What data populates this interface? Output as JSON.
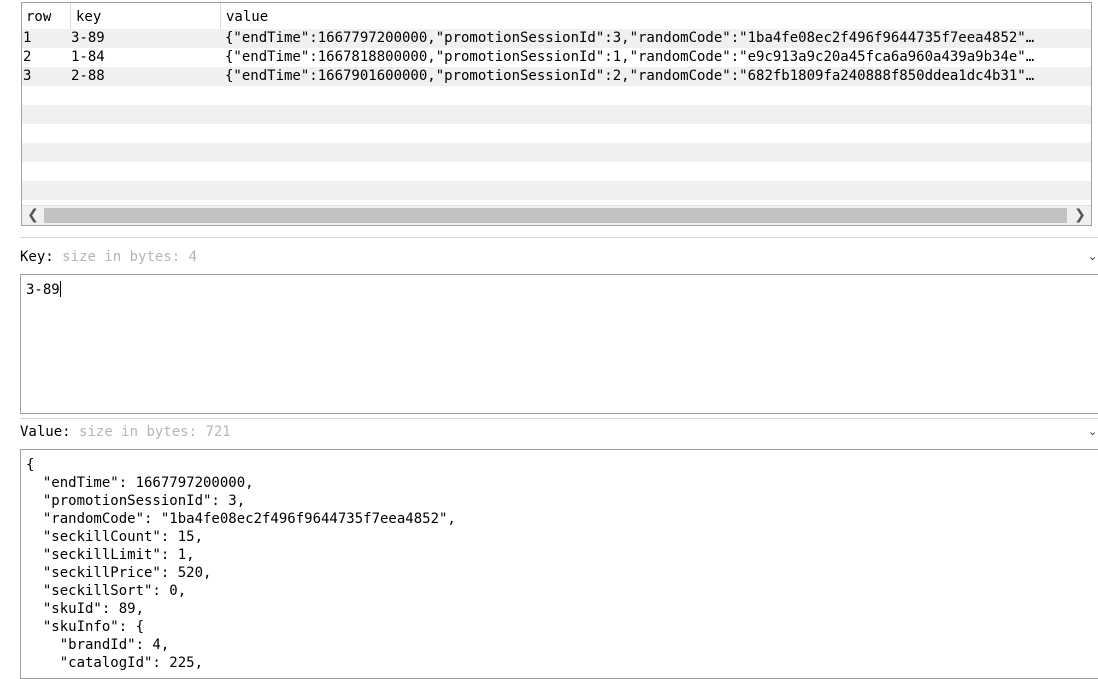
{
  "table": {
    "columns": [
      "row",
      "key",
      "value"
    ],
    "rows": [
      {
        "row": "1",
        "key": "3-89",
        "value": "{\"endTime\":1667797200000,\"promotionSessionId\":3,\"randomCode\":\"1ba4fe08ec2f496f9644735f7eea4852\"…"
      },
      {
        "row": "2",
        "key": "1-84",
        "value": "{\"endTime\":1667818800000,\"promotionSessionId\":1,\"randomCode\":\"e9c913a9c20a45fca6a960a439a9b34e\"…"
      },
      {
        "row": "3",
        "key": "2-88",
        "value": "{\"endTime\":1667901600000,\"promotionSessionId\":2,\"randomCode\":\"682fb1809fa240888f850ddea1dc4b31\"…"
      }
    ],
    "scroll_left_icon": "chevron-left-icon",
    "scroll_right_icon": "chevron-right-icon",
    "sort_icon": "sort-indicator-icon"
  },
  "key_panel": {
    "label": "Key:",
    "size_hint": "size in bytes: 4",
    "value": "3-89"
  },
  "value_panel": {
    "label": "Value:",
    "size_hint": "size in bytes: 721",
    "content": "{\n  \"endTime\": 1667797200000,\n  \"promotionSessionId\": 3,\n  \"randomCode\": \"1ba4fe08ec2f496f9644735f7eea4852\",\n  \"seckillCount\": 15,\n  \"seckillLimit\": 1,\n  \"seckillPrice\": 520,\n  \"seckillSort\": 0,\n  \"skuId\": 89,\n  \"skuInfo\": {\n    \"brandId\": 4,\n    \"catalogId\": 225,"
  }
}
